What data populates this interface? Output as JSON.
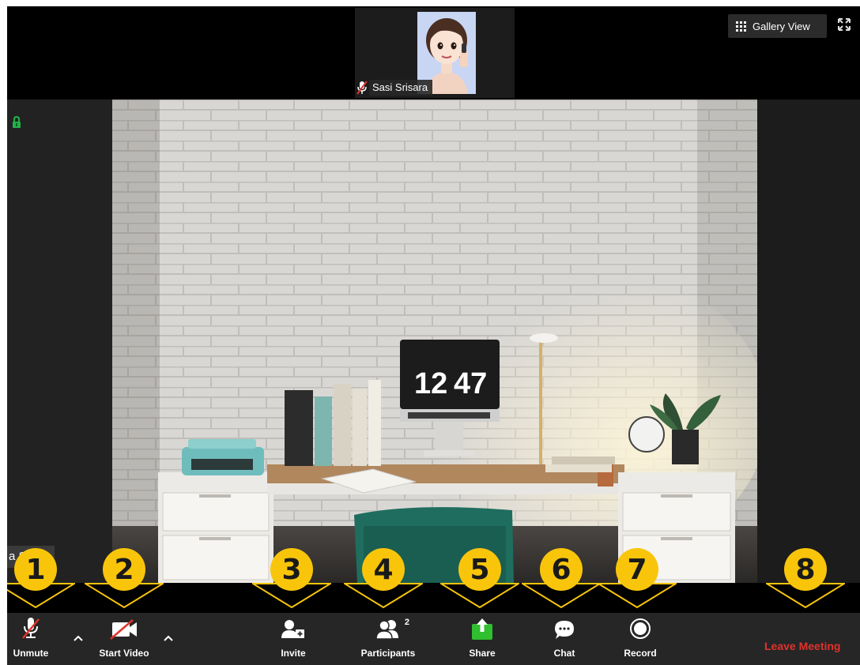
{
  "top": {
    "participant_name": "Sasi Srisara",
    "gallery_view_label": "Gallery View"
  },
  "self_view": {
    "name_partial": "a Srisar"
  },
  "main_video": {
    "clock_hours": "12",
    "clock_minutes": "47"
  },
  "toolbar": {
    "unmute_label": "Unmute",
    "start_video_label": "Start Video",
    "invite_label": "Invite",
    "participants_label": "Participants",
    "participants_count": "2",
    "share_label": "Share",
    "chat_label": "Chat",
    "record_label": "Record",
    "leave_label": "Leave Meeting"
  },
  "markers": [
    "1",
    "2",
    "3",
    "4",
    "5",
    "6",
    "7",
    "8"
  ],
  "colors": {
    "marker_fill": "#f9c50a",
    "leave_red": "#e0332c",
    "share_green": "#2fbf2f",
    "toolbar_bg": "#262626"
  },
  "icons": [
    "microphone-muted-icon",
    "video-off-icon",
    "invite-icon",
    "participants-icon",
    "share-icon",
    "chat-icon",
    "record-icon",
    "grid-icon",
    "fullscreen-icon",
    "lock-icon"
  ]
}
